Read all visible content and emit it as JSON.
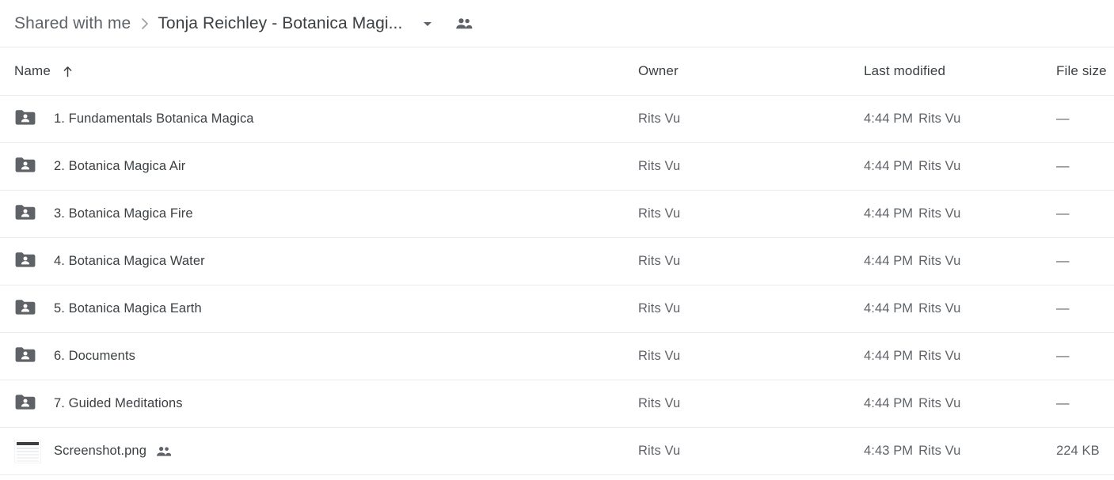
{
  "breadcrumb": {
    "root_label": "Shared with me",
    "separator": "›",
    "current_label": "Tonja Reichley - Botanica Magi...",
    "caret_icon": "chevron-down-icon",
    "share_icon": "people-shared-icon"
  },
  "table": {
    "columns": {
      "name": "Name",
      "owner": "Owner",
      "last_modified": "Last modified",
      "file_size": "File size"
    },
    "sort": {
      "column": "Name",
      "direction": "ascending",
      "icon": "arrow-up-icon"
    },
    "rows": [
      {
        "icon": "shared-folder-icon",
        "name": "1. Fundamentals Botanica Magica",
        "shared": false,
        "owner": "Rits Vu",
        "modified_time": "4:44 PM",
        "modified_by": "Rits Vu",
        "size": "—"
      },
      {
        "icon": "shared-folder-icon",
        "name": "2. Botanica Magica Air",
        "shared": false,
        "owner": "Rits Vu",
        "modified_time": "4:44 PM",
        "modified_by": "Rits Vu",
        "size": "—"
      },
      {
        "icon": "shared-folder-icon",
        "name": "3. Botanica Magica Fire",
        "shared": false,
        "owner": "Rits Vu",
        "modified_time": "4:44 PM",
        "modified_by": "Rits Vu",
        "size": "—"
      },
      {
        "icon": "shared-folder-icon",
        "name": "4. Botanica Magica Water",
        "shared": false,
        "owner": "Rits Vu",
        "modified_time": "4:44 PM",
        "modified_by": "Rits Vu",
        "size": "—"
      },
      {
        "icon": "shared-folder-icon",
        "name": "5. Botanica Magica Earth",
        "shared": false,
        "owner": "Rits Vu",
        "modified_time": "4:44 PM",
        "modified_by": "Rits Vu",
        "size": "—"
      },
      {
        "icon": "shared-folder-icon",
        "name": "6. Documents",
        "shared": false,
        "owner": "Rits Vu",
        "modified_time": "4:44 PM",
        "modified_by": "Rits Vu",
        "size": "—"
      },
      {
        "icon": "shared-folder-icon",
        "name": "7. Guided Meditations",
        "shared": false,
        "owner": "Rits Vu",
        "modified_time": "4:44 PM",
        "modified_by": "Rits Vu",
        "size": "—"
      },
      {
        "icon": "image-thumbnail",
        "name": "Screenshot.png",
        "shared": true,
        "owner": "Rits Vu",
        "modified_time": "4:43 PM",
        "modified_by": "Rits Vu",
        "size": "224 KB"
      }
    ]
  },
  "colors": {
    "background": "#ffffff",
    "divider": "#e8eaed",
    "primary_text": "#3c4043",
    "secondary_text": "#5f6368",
    "icon_gray": "#5f6368"
  }
}
